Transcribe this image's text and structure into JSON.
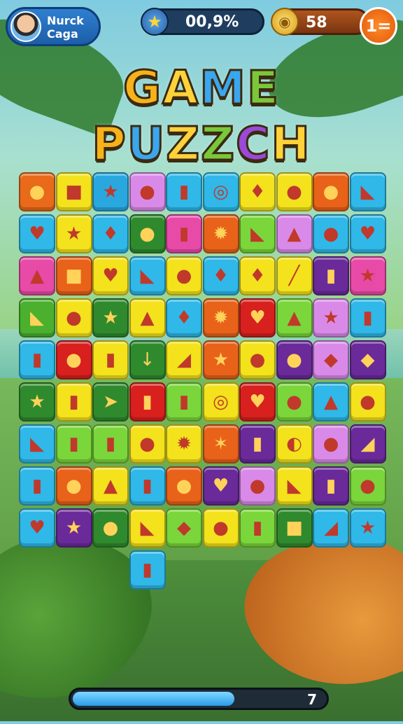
{
  "player": {
    "name_line1": "Nurck",
    "name_line2": "Caga"
  },
  "progress": {
    "text": "00,9%",
    "icon": "star-icon"
  },
  "coins": {
    "text": "58",
    "icon": "coin-icon"
  },
  "menu": {
    "label": "1="
  },
  "title": {
    "line1": [
      {
        "ch": "G",
        "color": "#f7b21a"
      },
      {
        "ch": "A",
        "color": "#ffd23a"
      },
      {
        "ch": "M",
        "color": "#3aa6ee"
      },
      {
        "ch": "E",
        "color": "#7ac83a"
      }
    ],
    "line2": [
      {
        "ch": "P",
        "color": "#f7b21a"
      },
      {
        "ch": "U",
        "color": "#3aa6ee"
      },
      {
        "ch": "Z",
        "color": "#ffd23a"
      },
      {
        "ch": "Z",
        "color": "#7ac83a"
      },
      {
        "ch": "C",
        "color": "#9a4ad6"
      },
      {
        "ch": "H",
        "color": "#ffd23a"
      }
    ]
  },
  "board": {
    "rows": [
      [
        "#e86a1a",
        "#f3e21c",
        "#29a8e0",
        "#d98ae8",
        "#2fb8e8",
        "#2fb8e8",
        "#f3e21c",
        "#f3e21c",
        "#e8621a",
        "#2fb8e8"
      ],
      [
        "#2fb8e8",
        "#f3e21c",
        "#2fb8e8",
        "#2f8a2e",
        "#e84aa8",
        "#e8621a",
        "#7ad63a",
        "#d98ae8",
        "#2fb8e8",
        "#2fb8e8"
      ],
      [
        "#e84aa8",
        "#e8621a",
        "#f3e21c",
        "#2fb8e8",
        "#f3e21c",
        "#2fb8e8",
        "#f3e21c",
        "#f3e21c",
        "#6a2a9a",
        "#e84aa8"
      ],
      [
        "#4ab02e",
        "#f3e21c",
        "#2f8a2e",
        "#f3e21c",
        "#2fb8e8",
        "#e8621a",
        "#d8201e",
        "#7ad63a",
        "#d98ae8",
        "#2fb8e8"
      ],
      [
        "#2fb8e8",
        "#d8201e",
        "#f3e21c",
        "#2f8a2e",
        "#f3e21c",
        "#e8621a",
        "#f3e21c",
        "#6a2a9a",
        "#d98ae8",
        "#6a2a9a"
      ],
      [
        "#2f8a2e",
        "#f3e21c",
        "#2f8a2e",
        "#d8201e",
        "#7ad63a",
        "#f3e21c",
        "#d8201e",
        "#7ad63a",
        "#2fb8e8",
        "#f3e21c"
      ],
      [
        "#2fb8e8",
        "#7ad63a",
        "#7ad63a",
        "#f3e21c",
        "#f3e21c",
        "#e8621a",
        "#6a2a9a",
        "#f3e21c",
        "#d98ae8",
        "#6a2a9a"
      ],
      [
        "#2fb8e8",
        "#e8621a",
        "#f3e21c",
        "#2fb8e8",
        "#e8621a",
        "#6a2a9a",
        "#d98ae8",
        "#f3e21c",
        "#6a2a9a",
        "#7ad63a"
      ],
      [
        "#2fb8e8",
        "#6a2a9a",
        "#2f8a2e",
        "#f3e21c",
        "#7ad63a",
        "#f3e21c",
        "#7ad63a",
        "#2f8a2e",
        "#2fb8e8",
        "#2fb8e8"
      ],
      [
        "",
        "",
        "",
        "#2fb8e8",
        "",
        "",
        "",
        "",
        "",
        ""
      ]
    ],
    "icons": [
      [
        "balloon-icon",
        "cheese-icon",
        "star-icon",
        "blob-icon",
        "barrel-icon",
        "ring-icon",
        "pin-icon",
        "globe-icon",
        "apple-icon",
        "shell-icon"
      ],
      [
        "heart-icon",
        "star-icon",
        "gourd-icon",
        "globe-icon",
        "cup-icon",
        "sun-icon",
        "horn-icon",
        "drop-icon",
        "slime-icon",
        "apple-icon"
      ],
      [
        "leaf-icon",
        "box-icon",
        "heart-icon",
        "feather-icon",
        "orange-icon",
        "pepper-icon",
        "lollipop-icon",
        "stick-icon",
        "bottle-icon",
        "star-icon"
      ],
      [
        "feather-icon",
        "blob-icon",
        "star-icon",
        "leaf-icon",
        "gourd-icon",
        "burst-icon",
        "heart-icon",
        "leaf-icon",
        "star-icon",
        "mug-icon"
      ],
      [
        "jar-icon",
        "lemon-icon",
        "mug-icon",
        "arrow-icon",
        "axe-icon",
        "star-icon",
        "gem-icon",
        "lemon-icon",
        "bird-icon",
        "shield-icon"
      ],
      [
        "star-icon",
        "pot-icon",
        "cursor-icon",
        "jar-icon",
        "cup-icon",
        "lock-icon",
        "heart-icon",
        "globe-icon",
        "drop-icon",
        "egg-icon"
      ],
      [
        "shell-icon",
        "mug-icon",
        "mug-icon",
        "ball-icon",
        "burst-icon",
        "star-icon",
        "bottle-icon",
        "seed-icon",
        "radish-icon",
        "horn-icon"
      ],
      [
        "bottle-icon",
        "egg-icon",
        "leaf-icon",
        "jar-icon",
        "blob-icon",
        "heart-icon",
        "blob-icon",
        "cone-icon",
        "cup-icon",
        "slime-icon"
      ],
      [
        "heart-icon",
        "star-icon",
        "cherry-icon",
        "cone-icon",
        "shield-icon",
        "bird-icon",
        "bottle-icon",
        "box-icon",
        "wedge-icon",
        "star-icon"
      ],
      [
        "",
        "",
        "",
        "jar-icon",
        "",
        "",
        "",
        "",
        "",
        ""
      ]
    ],
    "glyphs": [
      [
        "●",
        "■",
        "★",
        "●",
        "▮",
        "◎",
        "♦",
        "●",
        "●",
        "◣"
      ],
      [
        "♥",
        "★",
        "♦",
        "●",
        "▮",
        "✹",
        "◣",
        "▲",
        "●",
        "♥"
      ],
      [
        "▲",
        "■",
        "♥",
        "◣",
        "●",
        "♦",
        "♦",
        "╱",
        "▮",
        "★"
      ],
      [
        "◣",
        "●",
        "★",
        "▲",
        "♦",
        "✹",
        "♥",
        "▲",
        "★",
        "▮"
      ],
      [
        "▮",
        "●",
        "▮",
        "↓",
        "◢",
        "★",
        "●",
        "●",
        "◆",
        "◆"
      ],
      [
        "★",
        "▮",
        "➤",
        "▮",
        "▮",
        "◎",
        "♥",
        "●",
        "▲",
        "●"
      ],
      [
        "◣",
        "▮",
        "▮",
        "●",
        "✹",
        "✶",
        "▮",
        "◐",
        "●",
        "◢"
      ],
      [
        "▮",
        "●",
        "▲",
        "▮",
        "●",
        "♥",
        "●",
        "◣",
        "▮",
        "●"
      ],
      [
        "♥",
        "★",
        "●",
        "◣",
        "◆",
        "●",
        "▮",
        "■",
        "◢",
        "★"
      ],
      [
        "",
        "",
        "",
        "▮",
        "",
        "",
        "",
        "",
        "",
        ""
      ]
    ]
  },
  "level_bar": {
    "fill_fraction": 0.63,
    "value": "7"
  }
}
